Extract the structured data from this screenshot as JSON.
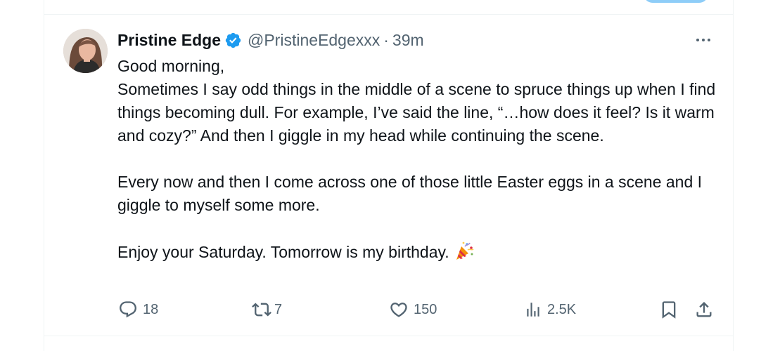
{
  "tweet": {
    "author_name": "Pristine Edge",
    "handle": "@PristineEdgexxx",
    "separator": "·",
    "time": "39m",
    "verified": true,
    "avatar_icon": "profile-photo",
    "body": {
      "line1": "Good morning,",
      "para1": "Sometimes I say odd things in the middle of a scene to spruce things up when I find things becoming dull. For example, I’ve said the line, “…how does it feel? Is it warm and cozy?” And then I giggle in my head while continuing the scene.",
      "para2": "Every now and then I come across one of those little Easter eggs in a scene and I giggle to myself some more.",
      "para3": "Enjoy your Saturday. Tomorrow is my birthday.",
      "emoji_icon": "party-popper"
    },
    "actions": {
      "replies": "18",
      "reposts": "7",
      "likes": "150",
      "views": "2.5K"
    }
  },
  "colors": {
    "text": "#0f1419",
    "secondary": "#536471",
    "verified": "#1d9bf0",
    "divider": "#eff3f4"
  }
}
